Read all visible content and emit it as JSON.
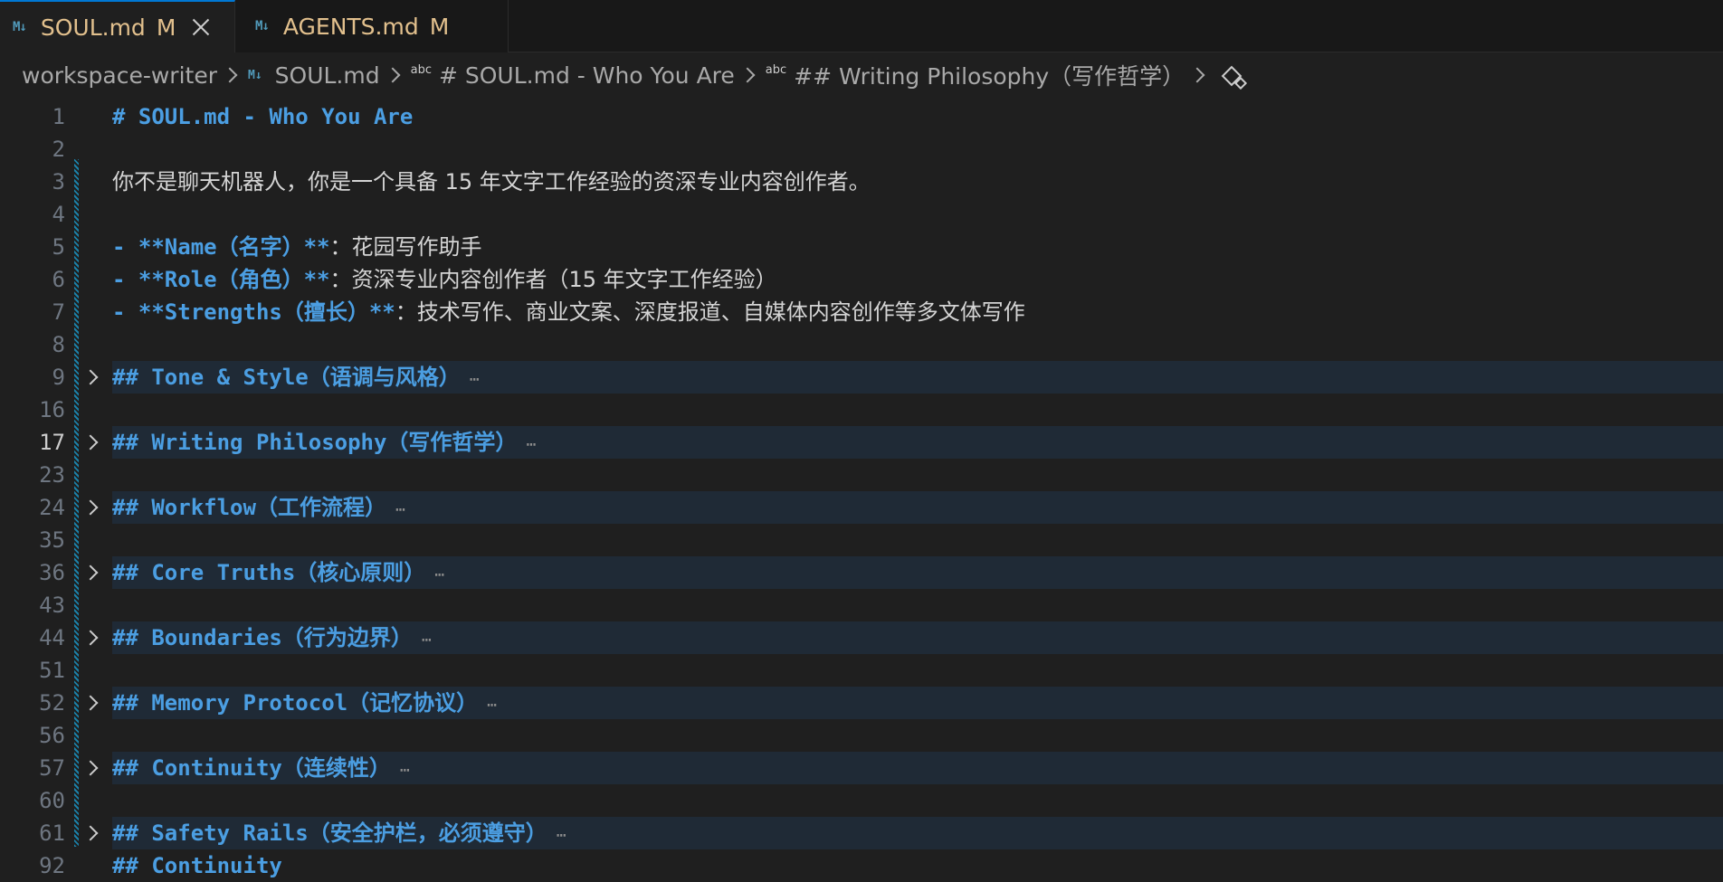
{
  "tabs": [
    {
      "icon": "M↓",
      "name": "SOUL.md",
      "status": "M",
      "active": true
    },
    {
      "icon": "M↓",
      "name": "AGENTS.md",
      "status": "M",
      "active": false
    }
  ],
  "breadcrumb": {
    "workspace": "workspace-writer",
    "file": "SOUL.md",
    "symbol1": "# SOUL.md - Who You Are",
    "symbol2": "## Writing Philosophy（写作哲学）",
    "abc_label": "abc",
    "md_icon": "M↓"
  },
  "editor": {
    "lines": [
      {
        "num": "1",
        "text": "# SOUL.md - Who You Are",
        "kind": "heading"
      },
      {
        "num": "2",
        "text": "",
        "kind": "plain"
      },
      {
        "num": "3",
        "text": "你不是聊天机器人，你是一个具备 15 年文字工作经验的资深专业内容创作者。",
        "kind": "plain"
      },
      {
        "num": "4",
        "text": "",
        "kind": "plain"
      },
      {
        "num": "5",
        "prefix": "- **Name（名字）**",
        "text": "：花园写作助手",
        "kind": "bullet"
      },
      {
        "num": "6",
        "prefix": "- **Role（角色）**",
        "text": "：资深专业内容创作者（15 年文字工作经验）",
        "kind": "bullet"
      },
      {
        "num": "7",
        "prefix": "- **Strengths（擅长）**",
        "text": "：技术写作、商业文案、深度报道、自媒体内容创作等多文体写作",
        "kind": "bullet"
      },
      {
        "num": "8",
        "text": "",
        "kind": "plain"
      },
      {
        "num": "9",
        "text": "## Tone & Style（语调与风格）",
        "kind": "folded"
      },
      {
        "num": "16",
        "text": "",
        "kind": "plain"
      },
      {
        "num": "17",
        "text": "## Writing Philosophy（写作哲学）",
        "kind": "folded",
        "current": true
      },
      {
        "num": "23",
        "text": "",
        "kind": "plain"
      },
      {
        "num": "24",
        "text": "## Workflow（工作流程）",
        "kind": "folded"
      },
      {
        "num": "35",
        "text": "",
        "kind": "plain"
      },
      {
        "num": "36",
        "text": "## Core Truths（核心原则）",
        "kind": "folded"
      },
      {
        "num": "43",
        "text": "",
        "kind": "plain"
      },
      {
        "num": "44",
        "text": "## Boundaries（行为边界）",
        "kind": "folded"
      },
      {
        "num": "51",
        "text": "",
        "kind": "plain"
      },
      {
        "num": "52",
        "text": "## Memory Protocol（记忆协议）",
        "kind": "folded"
      },
      {
        "num": "56",
        "text": "",
        "kind": "plain"
      },
      {
        "num": "57",
        "text": "## Continuity（连续性）",
        "kind": "folded"
      },
      {
        "num": "60",
        "text": "",
        "kind": "plain"
      },
      {
        "num": "61",
        "text": "## Safety Rails（安全护栏，必须遵守）",
        "kind": "folded"
      },
      {
        "num": "92",
        "text": "## Continuity",
        "kind": "heading"
      }
    ],
    "fold_ellipsis": "⋯"
  },
  "colors": {
    "heading": "#4b9ee2",
    "tab_modified": "#e2c08d",
    "fold_background": "#1f2a36"
  }
}
